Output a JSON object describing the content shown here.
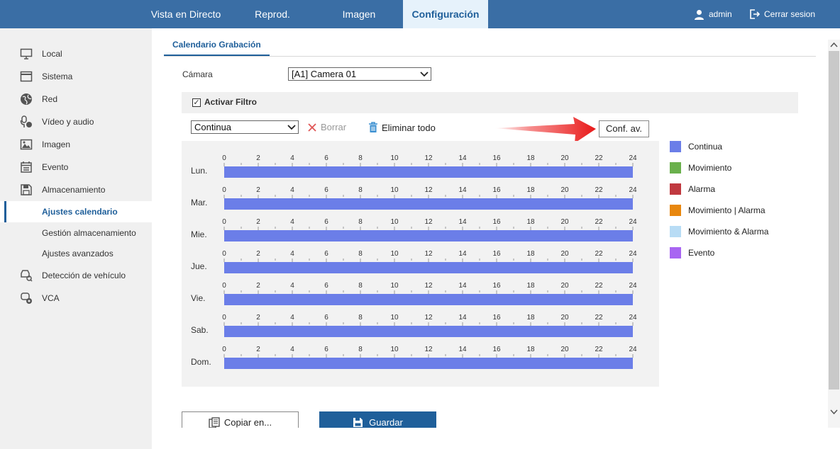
{
  "nav": {
    "items": [
      {
        "label": "Vista en Directo",
        "active": false
      },
      {
        "label": "Reprod.",
        "active": false
      },
      {
        "label": "Imagen",
        "active": false
      },
      {
        "label": "Configuración",
        "active": true
      }
    ],
    "user": "admin",
    "logout": "Cerrar sesion"
  },
  "sidebar": {
    "items": [
      {
        "label": "Local",
        "icon": "monitor-icon"
      },
      {
        "label": "Sistema",
        "icon": "window-icon"
      },
      {
        "label": "Red",
        "icon": "globe-icon"
      },
      {
        "label": "Vídeo y audio",
        "icon": "microphone-icon"
      },
      {
        "label": "Imagen",
        "icon": "image-icon"
      },
      {
        "label": "Evento",
        "icon": "calendar-icon"
      },
      {
        "label": "Almacenamiento",
        "icon": "storage-icon"
      },
      {
        "label": "Ajustes calendario",
        "active": true
      },
      {
        "label": "Gestión almacenamiento"
      },
      {
        "label": "Ajustes avanzados"
      },
      {
        "label": "Detección de vehículo",
        "icon": "vehicle-detection-icon"
      },
      {
        "label": "VCA",
        "icon": "vca-icon"
      }
    ]
  },
  "tab": "Calendario Grabación",
  "camera": {
    "label": "Cámara",
    "value": "[A1] Camera 01"
  },
  "filter": {
    "label": "Activar Filtro",
    "checked": true
  },
  "toolbar": {
    "mode": "Continua",
    "delete": "Borrar",
    "delete_all": "Eliminar todo",
    "advanced": "Conf. av."
  },
  "schedule": {
    "ticks": [
      "0",
      "2",
      "4",
      "6",
      "8",
      "10",
      "12",
      "14",
      "16",
      "18",
      "20",
      "22",
      "24"
    ],
    "days": [
      "Lun.",
      "Mar.",
      "Mie.",
      "Jue.",
      "Vie.",
      "Sab.",
      "Dom."
    ],
    "bar_color": "#6b7ee8"
  },
  "legend": [
    {
      "label": "Continua",
      "color": "#6b7ee8"
    },
    {
      "label": "Movimiento",
      "color": "#6ab04c"
    },
    {
      "label": "Alarma",
      "color": "#c0393f"
    },
    {
      "label": "Movimiento | Alarma",
      "color": "#e8870e"
    },
    {
      "label": "Movimiento & Alarma",
      "color": "#b8dcf5"
    },
    {
      "label": "Evento",
      "color": "#a865f2"
    }
  ],
  "actions": {
    "copy": "Copiar en...",
    "save": "Guardar"
  }
}
